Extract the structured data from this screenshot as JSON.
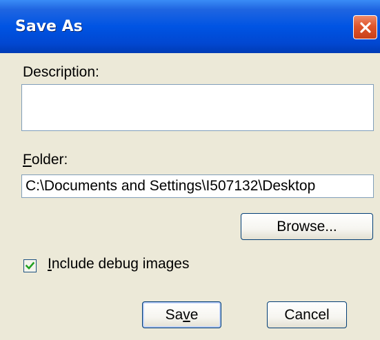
{
  "window": {
    "title": "Save As"
  },
  "description": {
    "label": "Description:",
    "value": ""
  },
  "folder": {
    "label_mnemonic": "F",
    "label_rest": "older:",
    "value": "C:\\Documents and Settings\\I507132\\Desktop"
  },
  "buttons": {
    "browse": "Browse...",
    "save_pre": "Sa",
    "save_mnemonic": "v",
    "save_post": "e",
    "cancel": "Cancel"
  },
  "debug_images": {
    "checked": true,
    "label_mnemonic": "I",
    "label_rest": "nclude debug images"
  },
  "icons": {
    "close": "close-icon",
    "check": "checkmark-icon"
  },
  "colors": {
    "titlebar": "#0054e3",
    "close_button": "#e0562c",
    "dialog_background": "#ece9d8",
    "field_border": "#7f9db9",
    "checkmark": "#21a121"
  }
}
